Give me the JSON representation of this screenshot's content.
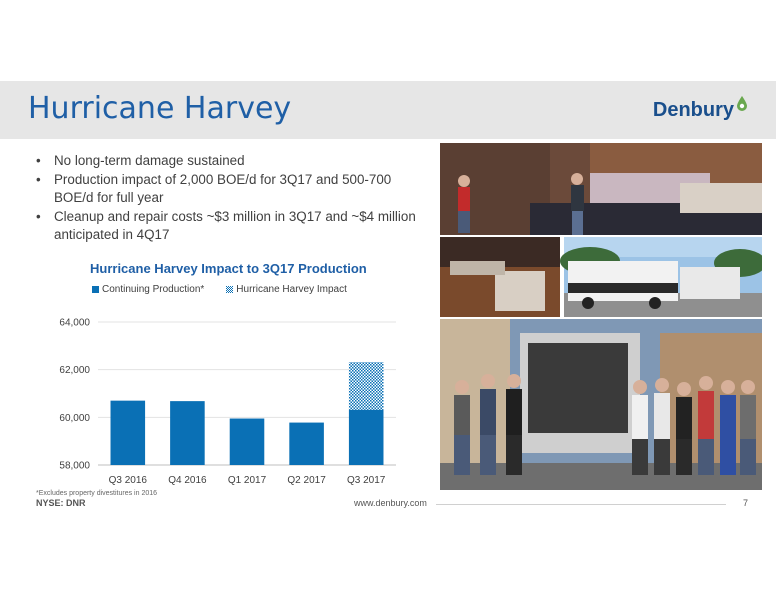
{
  "header": {
    "title": "Hurricane Harvey",
    "logo_text": "Denbury"
  },
  "bullets": [
    "No long-term damage sustained",
    "Production impact of 2,000 BOE/d for 3Q17 and 500-700 BOE/d for full year",
    "Cleanup and repair costs ~$3 million in 3Q17 and ~$4 million anticipated in 4Q17"
  ],
  "chart_data": {
    "type": "bar",
    "stacked": true,
    "title": "Hurricane Harvey Impact to 3Q17 Production",
    "categories": [
      "Q3 2016",
      "Q4 2016",
      "Q1 2017",
      "Q2 2017",
      "Q3 2017"
    ],
    "series": [
      {
        "name": "Continuing Production*",
        "values": [
          60700,
          60680,
          59950,
          59780,
          60320
        ],
        "color": "#0a70b5"
      },
      {
        "name": "Hurricane Harvey Impact",
        "values": [
          0,
          0,
          0,
          0,
          2000
        ],
        "color": "#0a70b5",
        "pattern": "crosshatch"
      }
    ],
    "ylim": [
      58000,
      64000
    ],
    "yticks": [
      "58,000",
      "60,000",
      "62,000",
      "64,000"
    ],
    "ytick_values": [
      58000,
      60000,
      62000,
      64000
    ],
    "grid": true,
    "legend": "top"
  },
  "footnote": "*Excludes property divestitures in 2016",
  "footer": {
    "ticker": "NYSE: DNR",
    "website": "www.denbury.com",
    "page": "7"
  },
  "colors": {
    "title_blue": "#1f5fa6",
    "bar_blue": "#0a70b5",
    "header_gray": "#e6e6e6",
    "logo_green": "#6aa84f"
  }
}
